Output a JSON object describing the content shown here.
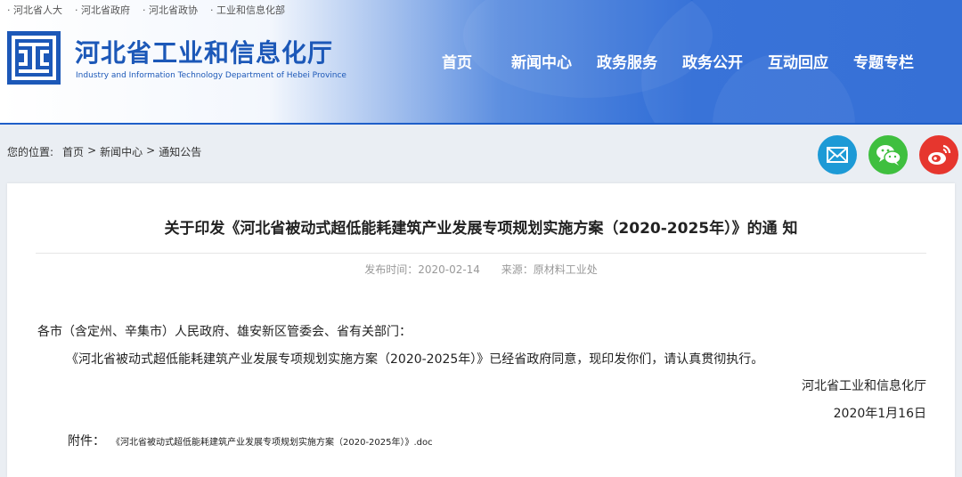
{
  "top_links": [
    "· 河北省人大",
    "· 河北省政府",
    "· 河北省政协",
    "· 工业和信息化部"
  ],
  "site": {
    "name": "河北省工业和信息化厅",
    "name_en": "Industry and Information Technology Department of Hebei Province"
  },
  "nav": [
    "首页",
    "新闻中心",
    "政务服务",
    "政务公开",
    "互动回应",
    "专题专栏"
  ],
  "breadcrumb": {
    "label": "您的位置:",
    "items": [
      "首页",
      ">",
      "新闻中心",
      ">",
      "通知公告"
    ]
  },
  "share_icons": [
    "email-icon",
    "wechat-icon",
    "weibo-icon"
  ],
  "colors": {
    "brand": "#1c58b8",
    "email": "#1d9ad6",
    "wechat": "#3fbf3f",
    "weibo": "#e6362e"
  },
  "article": {
    "title": "关于印发《河北省被动式超低能耗建筑产业发展专项规划实施方案（2020-2025年）》的通 知",
    "meta": {
      "date": "发布时间：2020-02-14",
      "source": "来源：原材料工业处"
    },
    "salutation": "各市（含定州、辛集市）人民政府、雄安新区管委会、省有关部门：",
    "body": "《河北省被动式超低能耗建筑产业发展专项规划实施方案（2020-2025年）》已经省政府同意，现印发你们，请认真贯彻执行。",
    "signer": "河北省工业和信息化厅",
    "date": "2020年1月16日",
    "attachment_label": "附件：",
    "attachment_file": "《河北省被动式超低能耗建筑产业发展专项规划实施方案（2020-2025年）》.doc"
  }
}
